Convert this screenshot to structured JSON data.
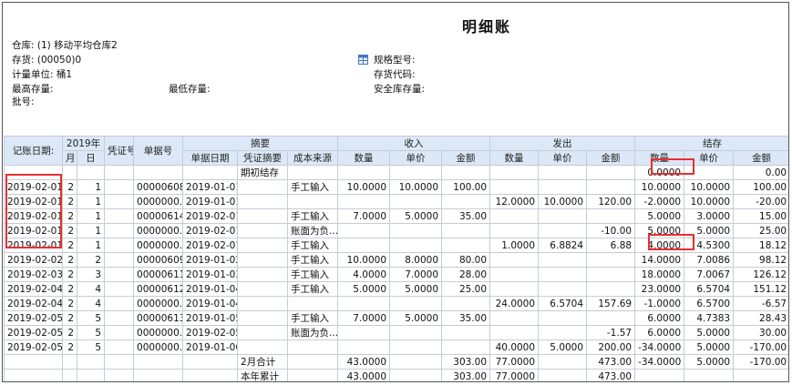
{
  "report": {
    "title": "明细账",
    "warehouse": "仓库: (1) 移动平均仓库2",
    "inventory": "存货: (00050)0",
    "unit": "计量单位: 桶1",
    "max_stock": "最高存量:",
    "min_stock": "最低存量:",
    "batch": "批号:",
    "spec": "规格型号:",
    "inv_code": "存货代码:",
    "safe_stock": "安全库存量:",
    "spec_icon": "table-icon"
  },
  "headers": {
    "date": "记账日期:",
    "year": "2019年",
    "month": "月",
    "day": "日",
    "voucher": "凭证号",
    "doc_no": "单据号",
    "summary": "摘要",
    "doc_date": "单据日期",
    "voucher_summary": "凭证摘要",
    "cost_source": "成本来源",
    "receive": "收入",
    "issue": "发出",
    "balance": "结存",
    "qty": "数量",
    "price": "单价",
    "amount": "金额"
  },
  "rows": [
    [
      "",
      "",
      "",
      "",
      "",
      "",
      "期初结存",
      "",
      "",
      "",
      "",
      "",
      "",
      "",
      "0.0000",
      "",
      "0.00"
    ],
    [
      "2019-02-01",
      "2",
      "1",
      "",
      "00000608",
      "2019-01-01",
      "",
      "手工输入",
      "10.0000",
      "10.0000",
      "100.00",
      "",
      "",
      "",
      "10.0000",
      "10.0000",
      "100.00"
    ],
    [
      "2019-02-01",
      "2",
      "1",
      "",
      "0000000...",
      "2019-01-01",
      "",
      "",
      "",
      "",
      "",
      "12.0000",
      "10.0000",
      "120.00",
      "-2.0000",
      "10.0000",
      "-20.00"
    ],
    [
      "2019-02-01",
      "2",
      "1",
      "",
      "00000614",
      "2019-02-01",
      "",
      "手工输入",
      "7.0000",
      "5.0000",
      "35.00",
      "",
      "",
      "",
      "5.0000",
      "3.0000",
      "15.00"
    ],
    [
      "2019-02-01",
      "2",
      "1",
      "",
      "0000000...",
      "2019-02-01",
      "",
      "账面为负...",
      "",
      "",
      "",
      "",
      "",
      "-10.00",
      "5.0000",
      "5.0000",
      "25.00"
    ],
    [
      "2019-02-01",
      "2",
      "1",
      "",
      "0000000...",
      "2019-02-01",
      "",
      "手工输入",
      "",
      "",
      "",
      "1.0000",
      "6.8824",
      "6.88",
      "4.0000",
      "4.5300",
      "18.12"
    ],
    [
      "2019-02-02",
      "2",
      "2",
      "",
      "00000609",
      "2019-01-02",
      "",
      "手工输入",
      "10.0000",
      "8.0000",
      "80.00",
      "",
      "",
      "",
      "14.0000",
      "7.0086",
      "98.12"
    ],
    [
      "2019-02-03",
      "2",
      "3",
      "",
      "00000611",
      "2019-01-03",
      "",
      "手工输入",
      "4.0000",
      "7.0000",
      "28.00",
      "",
      "",
      "",
      "18.0000",
      "7.0067",
      "126.12"
    ],
    [
      "2019-02-04",
      "2",
      "4",
      "",
      "00000612",
      "2019-01-04",
      "",
      "手工输入",
      "5.0000",
      "5.0000",
      "25.00",
      "",
      "",
      "",
      "23.0000",
      "6.5704",
      "151.12"
    ],
    [
      "2019-02-04",
      "2",
      "4",
      "",
      "0000000...",
      "2019-01-04",
      "",
      "",
      "",
      "",
      "",
      "24.0000",
      "6.5704",
      "157.69",
      "-1.0000",
      "6.5700",
      "-6.57"
    ],
    [
      "2019-02-05",
      "2",
      "5",
      "",
      "00000613",
      "2019-01-05",
      "",
      "手工输入",
      "7.0000",
      "5.0000",
      "35.00",
      "",
      "",
      "",
      "6.0000",
      "4.7383",
      "28.43"
    ],
    [
      "2019-02-05",
      "2",
      "5",
      "",
      "0000000...",
      "2019-02-05",
      "",
      "账面为负...",
      "",
      "",
      "",
      "",
      "",
      "-1.57",
      "6.0000",
      "5.0000",
      "30.00"
    ],
    [
      "2019-02-05",
      "2",
      "5",
      "",
      "0000000...",
      "2019-01-06",
      "",
      "",
      "",
      "",
      "",
      "40.0000",
      "5.0000",
      "200.00",
      "-34.0000",
      "5.0000",
      "-170.00"
    ],
    [
      "",
      "",
      "",
      "",
      "",
      "",
      "2月合计",
      "",
      "43.0000",
      "",
      "303.00",
      "77.0000",
      "",
      "473.00",
      "-34.0000",
      "5.0000",
      "-170.00"
    ],
    [
      "",
      "",
      "",
      "",
      "",
      "",
      "本年累计",
      "",
      "43.0000",
      "",
      "303.00",
      "77.0000",
      "",
      "473.00",
      "",
      "",
      ""
    ]
  ],
  "colors": {
    "header_bg": "#dce8f7",
    "highlight": "#e53030"
  }
}
